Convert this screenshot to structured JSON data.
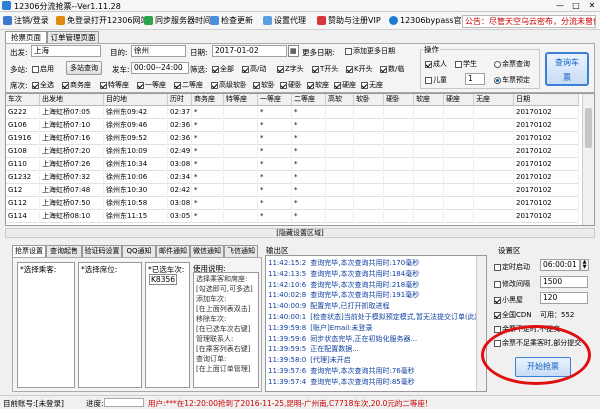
{
  "window": {
    "title": "12306分流抢票--Ver1.11.28",
    "minimize": "—",
    "maximize": "□",
    "close": "✕"
  },
  "menu": {
    "items": [
      {
        "label": "注销/登录",
        "icon": "login-icon"
      },
      {
        "label": "免登录打开12306网站",
        "icon": "browser-icon"
      },
      {
        "label": "同步服务器时间",
        "icon": "sync-icon"
      },
      {
        "label": "检查更新",
        "icon": "update-icon"
      },
      {
        "label": "设置代理",
        "icon": "proxy-icon"
      },
      {
        "label": "赞助与注册VIP",
        "icon": "heart-icon"
      },
      {
        "label": "12306bypass官网",
        "icon": "globe-icon"
      }
    ],
    "notice": "公告：尽管天空乌云密布，分流未曾停下脚步！"
  },
  "tabs": [
    "抢票页面",
    "订单管理页面"
  ],
  "query": {
    "from_label": "出发:",
    "from_value": "上海",
    "to_label": "目的:",
    "to_value": "徐州",
    "date_label": "日期:",
    "date_value": "2017-01-02",
    "more_dates_label": "更多日期:",
    "add_more_dates": "添加更多日期",
    "multi_station_label": "多站:",
    "enable_label": "启用",
    "multi_query_btn": "多站查询",
    "depart_time_label": "发车:",
    "depart_time_value": "00:00--24:00",
    "filter_label": "筛选:",
    "filters": [
      "全部",
      "高/动",
      "Z字头",
      "T开头",
      "K开头",
      "数/临"
    ],
    "seat_label": "席次:",
    "seats": [
      "全选",
      "商务座",
      "特等座",
      "一等座",
      "二等座",
      "高级软卧",
      "软卧",
      "硬卧",
      "软座",
      "硬座",
      "无座"
    ],
    "operation_label": "操作",
    "passenger_types": [
      "成人",
      "学生",
      "儿童"
    ],
    "ticket_types": [
      "余票查询",
      "车票预定"
    ],
    "qty": "1",
    "query_button": "查询车票"
  },
  "table": {
    "headers": [
      "车次",
      "出发地",
      "目的地",
      "历时",
      "商务座",
      "特等座",
      "一等座",
      "二等座",
      "高软",
      "软卧",
      "硬卧",
      "软座",
      "硬座",
      "无座",
      "日期"
    ],
    "rows": [
      [
        "G222",
        "上海虹桥07:05",
        "徐州东09:42",
        "02:37",
        "*",
        "",
        "*",
        "*",
        "",
        "",
        "",
        "",
        "",
        "",
        "20170102"
      ],
      [
        "G106",
        "上海虹桥07:10",
        "徐州东09:46",
        "02:36",
        "*",
        "",
        "*",
        "*",
        "",
        "",
        "",
        "",
        "",
        "",
        "20170102"
      ],
      [
        "G1916",
        "上海虹桥07:16",
        "徐州东09:52",
        "02:36",
        "*",
        "",
        "*",
        "*",
        "",
        "",
        "",
        "",
        "",
        "",
        "20170102"
      ],
      [
        "G108",
        "上海虹桥07:20",
        "徐州东10:09",
        "02:49",
        "*",
        "",
        "*",
        "*",
        "",
        "",
        "",
        "",
        "",
        "",
        "20170102"
      ],
      [
        "G110",
        "上海虹桥07:26",
        "徐州东10:34",
        "03:08",
        "*",
        "",
        "*",
        "*",
        "",
        "",
        "",
        "",
        "",
        "",
        "20170102"
      ],
      [
        "G1232",
        "上海虹桥07:32",
        "徐州东10:06",
        "02:34",
        "*",
        "",
        "*",
        "*",
        "",
        "",
        "",
        "",
        "",
        "",
        "20170102"
      ],
      [
        "G12",
        "上海虹桥07:48",
        "徐州东10:30",
        "02:42",
        "*",
        "",
        "*",
        "*",
        "",
        "",
        "",
        "",
        "",
        "",
        "20170102"
      ],
      [
        "G112",
        "上海虹桥07:50",
        "徐州东10:58",
        "03:08",
        "*",
        "",
        "*",
        "*",
        "",
        "",
        "",
        "",
        "",
        "",
        "20170102"
      ],
      [
        "G114",
        "上海虹桥08:10",
        "徐州东11:15",
        "03:05",
        "*",
        "",
        "*",
        "*",
        "",
        "",
        "",
        "",
        "",
        "",
        "20170102"
      ]
    ]
  },
  "hidden_settings": "[隐藏设置区域]",
  "bottom_tabs": [
    "抢票设置",
    "查询起售",
    "验证码设置",
    "QQ通知",
    "邮件通知",
    "微信通知",
    "飞信通知"
  ],
  "settings": {
    "choose_passengers": "*选择乘客:",
    "choose_seats": "*选择席位:",
    "selected_trains": "*已选车次:",
    "selected_train_value": "K8356",
    "usage_label": "使用说明:",
    "usage_text": [
      "选择乘客和席座:",
      "[勾选即可,可多选]",
      "添加车次:",
      "[在上面列表双击]",
      "移除车次:",
      "[在已选车次右键]",
      "管理联系人:",
      "[在乘客列表右键]",
      "查询订单:",
      "[在上面订单管理]"
    ]
  },
  "log": {
    "title": "输出区",
    "lines": [
      {
        "time": "11:42:15:2",
        "msg": "查询完毕,本次查询共用时:170毫秒"
      },
      {
        "time": "11:42:13:5",
        "msg": "查询完毕,本次查询共用时:184毫秒"
      },
      {
        "time": "11:42:10:6",
        "msg": "查询完毕,本次查询共用时:218毫秒"
      },
      {
        "time": "11:40:02:8",
        "msg": "查询完毕,本次查询共用时:191毫秒"
      },
      {
        "time": "11:40:00:9",
        "msg": "配置完毕,已打开抓取进程"
      },
      {
        "time": "11:40:00:1",
        "msg": "[检查状态]当前处于模拟预定模式,暂无法提交订单(此提示可以忽略)"
      },
      {
        "time": "11:39:59:8",
        "msg": "[账户]Email:未登录"
      },
      {
        "time": "11:39:59:6",
        "msg": "同步状态完毕,正在初始化服务器..."
      },
      {
        "time": "11:39:59:5",
        "msg": "正在配置数据..."
      },
      {
        "time": "11:39:58:0",
        "msg": "[代理]未开启"
      },
      {
        "time": "11:39:57:6",
        "msg": "查询完毕,本次查询共用时:76毫秒"
      },
      {
        "time": "11:39:57:4",
        "msg": "查询完毕,本次查询共用时:85毫秒"
      }
    ]
  },
  "settings_area": {
    "title": "设置区",
    "timed_start": "定时启动",
    "timed_value": "06:00:01",
    "modify_interval": "修改间隔",
    "interval_value": "1500",
    "blacklist": "小黑屋",
    "blacklist_value": "120",
    "cdn": "全国CDN",
    "cdn_count": "可用：552",
    "submit_when_short": "余票不足时,不提交",
    "submit_partial": "余票不足乘客时,部分提交",
    "start_button": "开始抢票"
  },
  "statusbar": {
    "account": "目前账号:[未登录]",
    "progress_label": "进度:",
    "marquee": "用户:***在12:20:00抢到了2016-11-25,昆明-广州南,C7718车次,20.0元的二等座!"
  }
}
